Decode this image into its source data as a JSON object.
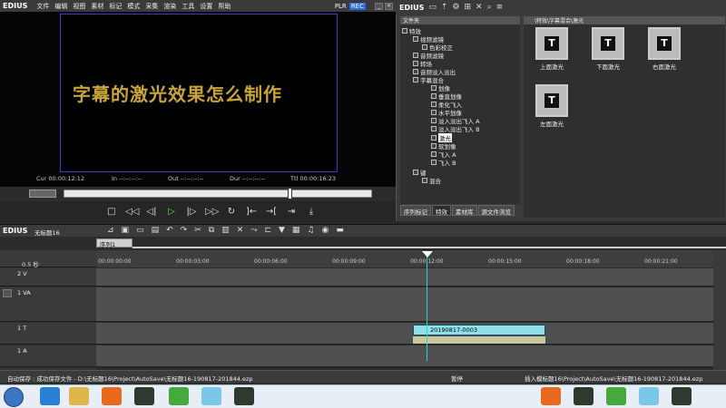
{
  "app": {
    "name": "EDIUS"
  },
  "menu": [
    "文件",
    "编辑",
    "视图",
    "素材",
    "标记",
    "模式",
    "采集",
    "渲染",
    "工具",
    "设置",
    "帮助"
  ],
  "player": {
    "plr": "PLR",
    "rec": "REC",
    "title_text": "字幕的激光效果怎么制作",
    "cur_label": "Cur",
    "cur": "00:00:12:12",
    "in_label": "In",
    "in": "--:--:--:--",
    "out_label": "Out",
    "out": "--:--:--:--",
    "dur_label": "Dur",
    "dur": "--:--:--:--",
    "ttl_label": "Ttl",
    "ttl": "00:00:16:23"
  },
  "effects_panel": {
    "tree_header": "文件夹",
    "path": "\\特效\\字幕混合\\激光",
    "tree": [
      {
        "label": "特效",
        "depth": 0
      },
      {
        "label": "视频滤镜",
        "depth": 1
      },
      {
        "label": "色彩校正",
        "depth": 2
      },
      {
        "label": "音频滤镜",
        "depth": 1
      },
      {
        "label": "转场",
        "depth": 1
      },
      {
        "label": "音频淡入淡出",
        "depth": 1
      },
      {
        "label": "字幕混合",
        "depth": 1
      },
      {
        "label": "划像",
        "depth": 2
      },
      {
        "label": "垂直划像",
        "depth": 2
      },
      {
        "label": "柔化飞入",
        "depth": 2
      },
      {
        "label": "水平划像",
        "depth": 2
      },
      {
        "label": "淡入淡出飞入 A",
        "depth": 2
      },
      {
        "label": "淡入淡出飞入 B",
        "depth": 2
      },
      {
        "label": "激光",
        "depth": 2,
        "selected": true
      },
      {
        "label": "软划像",
        "depth": 2
      },
      {
        "label": "飞入 A",
        "depth": 2
      },
      {
        "label": "飞入 B",
        "depth": 2
      },
      {
        "label": "键",
        "depth": 1
      },
      {
        "label": "混合",
        "depth": 2
      }
    ],
    "items": [
      "上面激光",
      "下面激光",
      "右面激光",
      "左面激光"
    ],
    "tabs": [
      "序列标记",
      "特效",
      "素材库",
      "源文件浏览"
    ]
  },
  "timeline": {
    "project_name": "无标题16",
    "sequence_tab": "序列1",
    "zoom": "0.5 秒",
    "ruler": [
      "00:00:00:00",
      "00:00:03:00",
      "00:00:06:00",
      "00:00:09:00",
      "00:00:12:00",
      "00:00:15:00",
      "00:00:18:00",
      "00:00:21:00"
    ],
    "tracks": [
      "2 V",
      "1 VA",
      "1 T",
      "1 A"
    ],
    "clip_name": "20190817-0003"
  },
  "status": {
    "left": "自动保存 : 成功保存文件 - D:\\无标题16\\Project\\AutoSave\\无标题16-190817-201844.ezp",
    "mid": "暂停",
    "right": "插入模标题16\\Project\\AutoSave\\无标题16-190817-201844.ezp"
  },
  "colors": {
    "accent": "#2a6dd8",
    "playhead": "#2fd6c1",
    "clip": "#8fe0e8"
  }
}
